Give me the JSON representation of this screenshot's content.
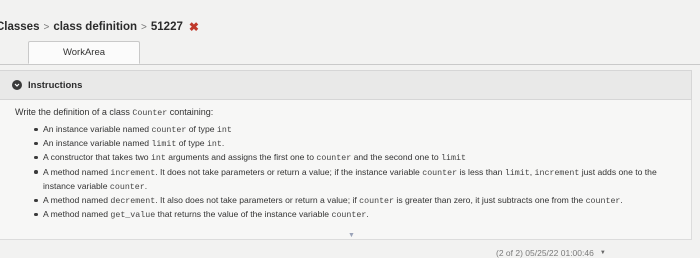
{
  "breadcrumb": {
    "items": [
      "Classes",
      "class definition",
      "51227"
    ],
    "separator": ">",
    "close_glyph": "✖"
  },
  "tabs": [
    {
      "label": "WorkArea"
    }
  ],
  "instructions": {
    "icon": "chevron-down-circle-icon",
    "title": "Instructions",
    "intro": [
      "Write the definition of a class ",
      "Counter",
      " containing:"
    ],
    "items": [
      [
        [
          "t",
          "An instance variable named "
        ],
        [
          "c",
          "counter"
        ],
        [
          "t",
          " of type "
        ],
        [
          "c",
          "int"
        ]
      ],
      [
        [
          "t",
          "An instance variable named "
        ],
        [
          "c",
          "limit"
        ],
        [
          "t",
          " of type "
        ],
        [
          "c",
          "int"
        ],
        [
          "t",
          "."
        ]
      ],
      [
        [
          "t",
          "A constructor that takes two "
        ],
        [
          "c",
          "int"
        ],
        [
          "t",
          " arguments and assigns the first one to "
        ],
        [
          "c",
          "counter"
        ],
        [
          "t",
          " and the second one to "
        ],
        [
          "c",
          "limit"
        ]
      ],
      [
        [
          "t",
          "A method named "
        ],
        [
          "c",
          "increment"
        ],
        [
          "t",
          ". It does not take parameters or return a value; if the instance variable "
        ],
        [
          "c",
          "counter"
        ],
        [
          "t",
          " is less than "
        ],
        [
          "c",
          "limit"
        ],
        [
          "t",
          ", "
        ],
        [
          "c",
          "increment"
        ],
        [
          "t",
          " just adds one to the instance variable "
        ],
        [
          "c",
          "counter"
        ],
        [
          "t",
          "."
        ]
      ],
      [
        [
          "t",
          "A method named "
        ],
        [
          "c",
          "decrement"
        ],
        [
          "t",
          ". It also does not take parameters or return a value; if "
        ],
        [
          "c",
          "counter"
        ],
        [
          "t",
          " is greater than zero, it just subtracts one from the "
        ],
        [
          "c",
          "counter"
        ],
        [
          "t",
          "."
        ]
      ],
      [
        [
          "t",
          "A method named "
        ],
        [
          "c",
          "get_value"
        ],
        [
          "t",
          " that returns the value of the instance variable "
        ],
        [
          "c",
          "counter"
        ],
        [
          "t",
          "."
        ]
      ]
    ]
  },
  "status": {
    "text": "(2 of 2) 05/25/22 01:00:46"
  },
  "colors": {
    "close": "#c0392b",
    "background": "#f2f2f1",
    "header": "#e9e9e8"
  }
}
